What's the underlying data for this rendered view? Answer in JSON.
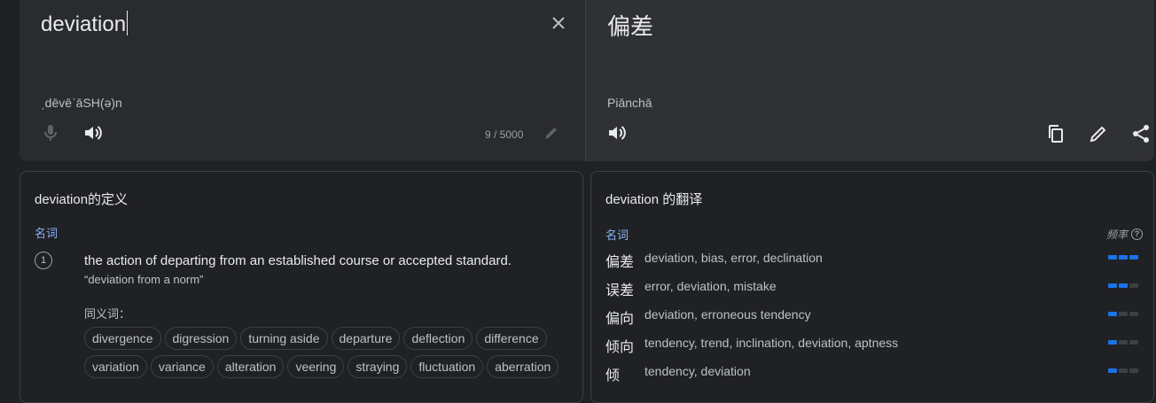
{
  "source": {
    "text": "deviation",
    "transliteration": "ˌdēvēˈāSH(ə)n",
    "counter": "9 / 5000"
  },
  "target": {
    "text": "偏差",
    "transliteration": "Piānchā"
  },
  "definitions": {
    "title": "deviation的定义",
    "part_of_speech": "名词",
    "number": "1",
    "definition": "the action of departing from an established course or accepted standard.",
    "example": "“deviation from a norm”",
    "synonyms_label": "同义词：",
    "synonyms": [
      "divergence",
      "digression",
      "turning aside",
      "departure",
      "deflection",
      "difference",
      "variation",
      "variance",
      "alteration",
      "veering",
      "straying",
      "fluctuation",
      "aberration"
    ]
  },
  "translations": {
    "title": "deviation 的翻译",
    "part_of_speech": "名词",
    "frequency_label": "频率",
    "rows": [
      {
        "word": "偏差",
        "back": "deviation, bias, error, declination",
        "frequency": 3
      },
      {
        "word": "误差",
        "back": "error, deviation, mistake",
        "frequency": 2
      },
      {
        "word": "偏向",
        "back": "deviation, erroneous tendency",
        "frequency": 1
      },
      {
        "word": "倾向",
        "back": "tendency, trend, inclination, deviation, aptness",
        "frequency": 1
      },
      {
        "word": "倾",
        "back": "tendency, deviation",
        "frequency": 1
      }
    ]
  },
  "colors": {
    "accent": "#8ab4f8",
    "bar_on": "#1a73e8",
    "bar_off": "#3c4043"
  }
}
